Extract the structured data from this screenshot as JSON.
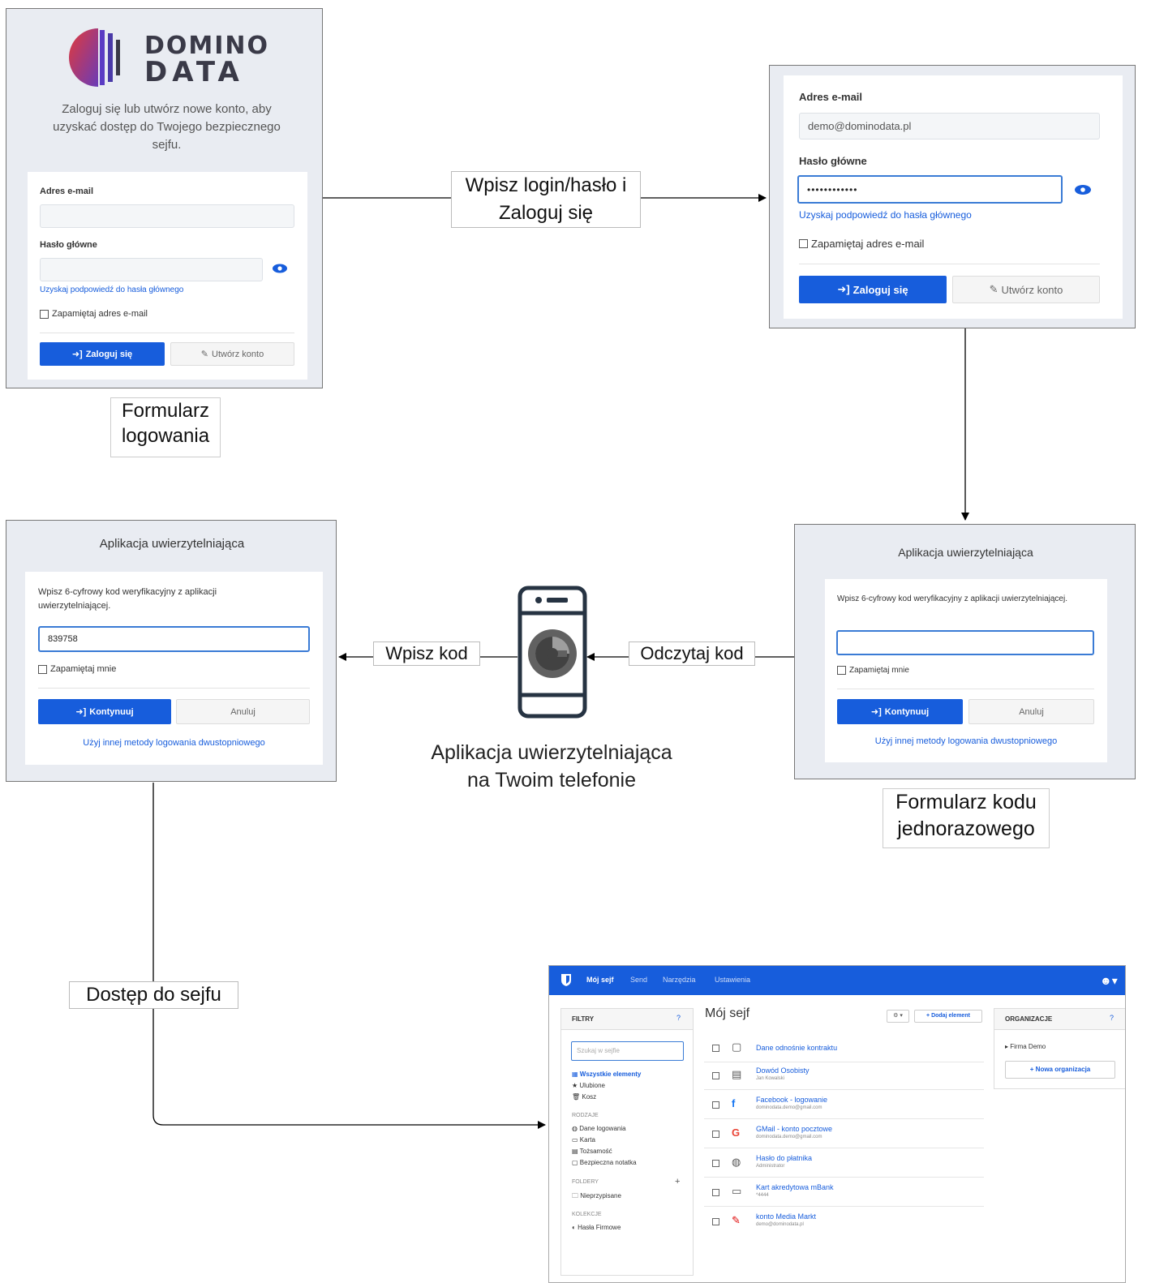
{
  "login_form": {
    "logo_line1": "DOMINO",
    "logo_line2": "DATA",
    "intro": "Zaloguj się lub utwórz nowe konto, aby uzyskać dostęp do Twojego bezpiecznego sejfu.",
    "email_label": "Adres e-mail",
    "email_value": "",
    "password_label": "Hasło główne",
    "hint_link": "Uzyskaj podpowiedź do hasła głównego",
    "remember_email": "Zapamiętaj adres e-mail",
    "login_button": "Zaloguj się",
    "create_button": "Utwórz konto"
  },
  "login_filled": {
    "email_label": "Adres e-mail",
    "email_value": "demo@dominodata.pl",
    "password_label": "Hasło główne",
    "password_value": "••••••••••••",
    "hint_link": "Uzyskaj podpowiedź do hasła głównego",
    "remember_email": "Zapamiętaj adres e-mail",
    "login_button": "Zaloguj się",
    "create_button": "Utwórz konto"
  },
  "otp_filled": {
    "title": "Aplikacja uwierzytelniająca",
    "instruction": "Wpisz 6-cyfrowy kod weryfikacyjny z aplikacji uwierzytelniającej.",
    "code_value": "839758",
    "remember_me": "Zapamiętaj mnie",
    "continue_button": "Kontynuuj",
    "cancel_button": "Anuluj",
    "other_method_link": "Użyj innej metody logowania dwustopniowego"
  },
  "otp_empty": {
    "title": "Aplikacja uwierzytelniająca",
    "instruction": "Wpisz 6-cyfrowy kod weryfikacyjny z aplikacji uwierzytelniającej.",
    "code_value": "",
    "remember_me": "Zapamiętaj mnie",
    "continue_button": "Kontynuuj",
    "cancel_button": "Anuluj",
    "other_method_link": "Użyj innej metody logowania dwustopniowego"
  },
  "captions": {
    "login_form": "Formularz logowania",
    "otp_form": "Formularz kodu jednorazowego",
    "phone_app": "Aplikacja uwierzytelniająca na Twoim telefonie"
  },
  "edges": {
    "login_to_filled": "Wpisz login/hasło i Zaloguj się",
    "enter_code": "Wpisz kod",
    "read_code": "Odczytaj kod",
    "vault_access": "Dostęp do sejfu"
  },
  "vault": {
    "nav": [
      "Mój sejf",
      "Send",
      "Narzędzia",
      "Ustawienia"
    ],
    "filters_title": "FILTRY",
    "search_placeholder": "Szukaj w sejfie",
    "all_items": "Wszystkie elementy",
    "favorites": "Ulubione",
    "trash": "Kosz",
    "types_title": "RODZAJE",
    "types": [
      "Dane logowania",
      "Karta",
      "Tożsamość",
      "Bezpieczna notatka"
    ],
    "folders_title": "FOLDERY",
    "folders": [
      "Nieprzypisane"
    ],
    "collections_title": "KOLEKCJE",
    "collections": [
      "Hasła Firmowe"
    ],
    "main_title": "Mój sejf",
    "add_button": "+ Dodaj element",
    "items": [
      {
        "name": "Dane odnośnie kontraktu",
        "sub": "",
        "icon": "note-icon"
      },
      {
        "name": "Dowód Osobisty",
        "sub": "Jan Kowalski",
        "icon": "id-card-icon"
      },
      {
        "name": "Facebook - logowanie",
        "sub": "dominodata.demo@gmail.com",
        "icon": "facebook-icon"
      },
      {
        "name": "GMail - konto pocztowe",
        "sub": "dominodata.demo@gmail.com",
        "icon": "google-icon"
      },
      {
        "name": "Hasło do płatnika",
        "sub": "Administrator",
        "icon": "globe-icon"
      },
      {
        "name": "Kart akredytowa mBank",
        "sub": "*4444",
        "icon": "card-icon"
      },
      {
        "name": "konto Media Markt",
        "sub": "demo@dominodata.pl",
        "icon": "media-markt-icon"
      }
    ],
    "org_title": "ORGANIZACJE",
    "org_item": "Firma Demo",
    "new_org_button": "+ Nowa organizacja"
  },
  "colors": {
    "primary": "#175ddc",
    "panel_bg": "#e9ecf2",
    "logo_dark": "#3a3a48"
  }
}
